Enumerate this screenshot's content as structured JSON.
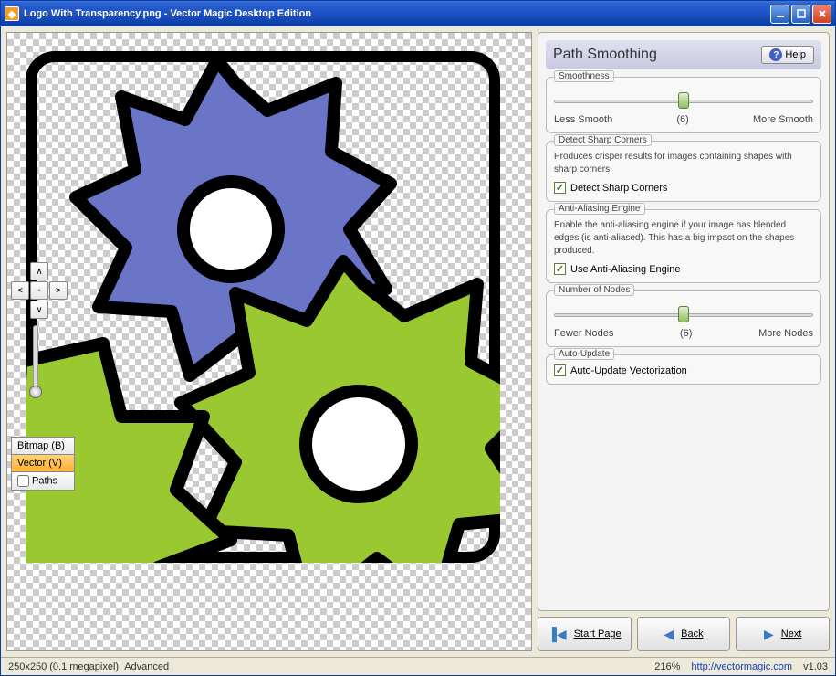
{
  "titlebar": {
    "filename": "Logo With Transparency.png",
    "appname": "Vector Magic Desktop Edition"
  },
  "viewTabs": {
    "bitmap": "Bitmap (B)",
    "vector": "Vector (V)",
    "paths": "Paths"
  },
  "panel": {
    "title": "Path Smoothing",
    "helpLabel": "Help",
    "smoothness": {
      "title": "Smoothness",
      "left": "Less Smooth",
      "value": "(6)",
      "right": "More Smooth"
    },
    "sharp": {
      "title": "Detect Sharp Corners",
      "desc": "Produces crisper results for images containing shapes with sharp corners.",
      "check": "Detect Sharp Corners"
    },
    "aa": {
      "title": "Anti-Aliasing Engine",
      "desc": "Enable the anti-aliasing engine if your image has blended edges (is anti-aliased). This has a big impact on the shapes produced.",
      "check": "Use Anti-Aliasing Engine"
    },
    "nodes": {
      "title": "Number of Nodes",
      "left": "Fewer Nodes",
      "value": "(6)",
      "right": "More Nodes"
    },
    "auto": {
      "title": "Auto-Update",
      "check": "Auto-Update Vectorization"
    }
  },
  "nav": {
    "start": "Start Page",
    "back": "Back",
    "next": "Next"
  },
  "status": {
    "dims": "250x250 (0.1 megapixel)",
    "mode": "Advanced",
    "zoom": "216%",
    "url": "http://vectormagic.com",
    "version": "v1.03"
  }
}
